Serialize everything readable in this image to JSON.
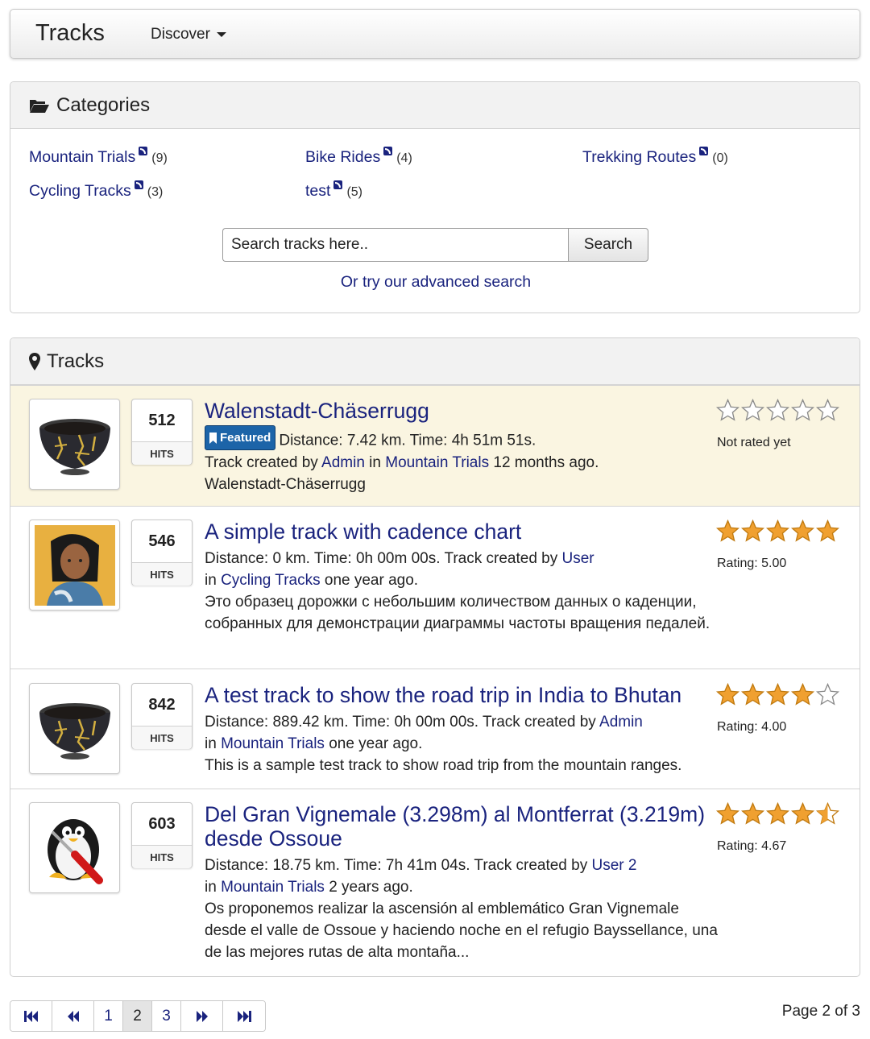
{
  "navbar": {
    "brand": "Tracks",
    "discover_label": "Discover"
  },
  "categories": {
    "heading": "Categories",
    "items": [
      {
        "label": "Mountain Trials",
        "count": "(9)"
      },
      {
        "label": "Bike Rides",
        "count": "(4)"
      },
      {
        "label": "Trekking Routes",
        "count": "(0)"
      },
      {
        "label": "Cycling Tracks",
        "count": "(3)"
      },
      {
        "label": "test",
        "count": "(5)"
      }
    ],
    "search_placeholder": "Search tracks here..",
    "search_button": "Search",
    "advanced_link": "Or try our advanced search"
  },
  "tracks": {
    "heading": "Tracks",
    "hits_label": "HITS",
    "items": [
      {
        "hits": "512",
        "title": "Walenstadt-Chäserrugg",
        "featured_label": "Featured",
        "stats": "Distance: 7.42 km. Time: 4h 51m 51s.",
        "by_prefix": "Track created by ",
        "author": "Admin",
        "in_word": " in ",
        "category": "Mountain Trials",
        "when": " 12 months ago.",
        "description": "Walenstadt-Chäserrugg",
        "rating_value": 0,
        "rating_text": "Not rated yet",
        "thumb_icon": "kintsugi-bowl-image"
      },
      {
        "hits": "546",
        "title": "A simple track with cadence chart",
        "line1_prefix": "Distance: 0 km. Time: 0h 00m 00s. Track created by ",
        "author": "User",
        "line2_prefix": "in ",
        "category": "Cycling Tracks",
        "when": " one year ago.",
        "description": "Это образец дорожки с небольшим количеством данных о каденции, собранных для демонстрации диаграммы частоты вращения педалей.",
        "rating_value": 5.0,
        "rating_text": "Rating: 5.00",
        "thumb_icon": "cartoon-character-image"
      },
      {
        "hits": "842",
        "title": "A test track to show the road trip in India to Bhutan",
        "line1_prefix": "Distance: 889.42 km. Time: 0h 00m 00s. Track created by ",
        "author": "Admin",
        "line2_prefix": "in ",
        "category": "Mountain Trials",
        "when": " one year ago.",
        "description": "This is a sample test track to show road trip from the mountain ranges.",
        "rating_value": 4.0,
        "rating_text": "Rating: 4.00",
        "thumb_icon": "kintsugi-bowl-image"
      },
      {
        "hits": "603",
        "title": "Del Gran Vignemale (3.298m) al Montferrat (3.219m) desde Ossoue",
        "line1_prefix": "Distance: 18.75 km. Time: 7h 41m 04s. Track created by ",
        "author": "User 2",
        "line2_prefix": "in ",
        "category": "Mountain Trials",
        "when": " 2 years ago.",
        "description": "Os proponemos realizar la ascensión al emblemático Gran Vignemale desde el valle de Ossoue y haciendo noche en el refugio Bayssellance, una de las mejores rutas de alta montaña...",
        "rating_value": 4.67,
        "rating_text": "Rating: 4.67",
        "thumb_icon": "penguin-screwdriver-image"
      }
    ]
  },
  "pagination": {
    "pages": [
      "1",
      "2",
      "3"
    ],
    "current": "2",
    "info": "Page 2 of 3",
    "icons": [
      "first-page-icon",
      "previous-page-icon",
      "next-page-icon",
      "last-page-icon"
    ]
  },
  "colors": {
    "link": "#1a237e",
    "featured_bg": "#faf5e1",
    "star": "#f0a030",
    "badge": "#1c64a8"
  }
}
